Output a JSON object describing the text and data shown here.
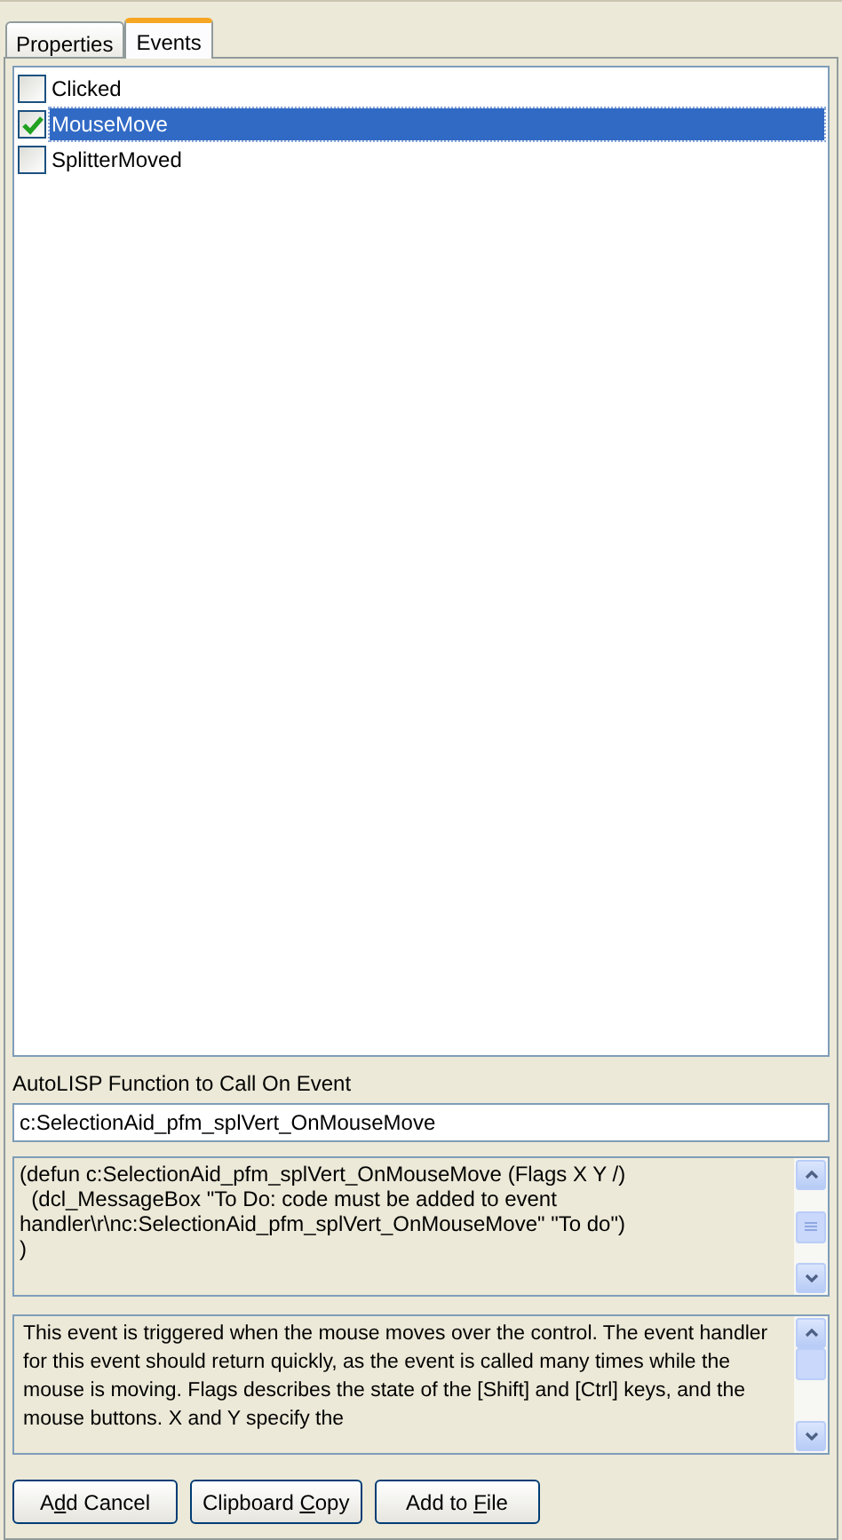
{
  "tabs": [
    {
      "label": "Properties",
      "selected": false
    },
    {
      "label": "Events",
      "selected": true
    }
  ],
  "events": [
    {
      "label": "Clicked",
      "checked": false,
      "selected": false
    },
    {
      "label": "MouseMove",
      "checked": true,
      "selected": true
    },
    {
      "label": "SplitterMoved",
      "checked": false,
      "selected": false
    }
  ],
  "function_label": "AutoLISP Function to Call On Event",
  "function_field": {
    "value": "c:SelectionAid_pfm_splVert_OnMouseMove"
  },
  "code_lines": [
    "(defun c:SelectionAid_pfm_splVert_OnMouseMove (Flags X Y /)",
    "  (dcl_MessageBox \"To Do: code must be added to event handler\\r\\nc:SelectionAid_pfm_splVert_OnMouseMove\" \"To do\")",
    ")"
  ],
  "description": "This event is triggered when the mouse moves over the control. The event handler for this event should return quickly, as the event is called many times while the mouse is moving. Flags describes the state of the [Shift] and [Ctrl] keys, and the mouse buttons. X and Y specify the",
  "buttons": [
    {
      "before": "A",
      "access_key": "d",
      "after": "d Cancel"
    },
    {
      "before": "Clipboard ",
      "access_key": "C",
      "after": "opy"
    },
    {
      "before": "Add to ",
      "access_key": "F",
      "after": "ile"
    }
  ]
}
